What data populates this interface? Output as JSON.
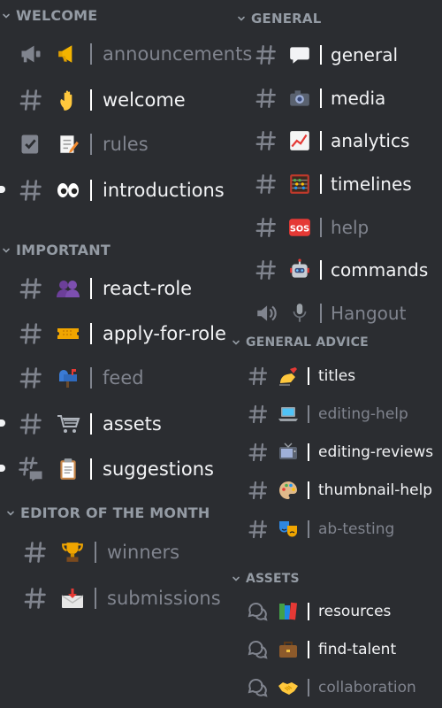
{
  "left": {
    "welcome": {
      "header": "WELCOME",
      "channels": [
        {
          "name": "announcements",
          "icon": "megaphone-icon",
          "emoji": "megaphone-emoji",
          "unread": false
        },
        {
          "name": "welcome",
          "icon": "hash-icon",
          "emoji": "waving-hand-emoji",
          "unread": true
        },
        {
          "name": "rules",
          "icon": "rules-icon",
          "emoji": "memo-emoji",
          "unread": false
        },
        {
          "name": "introductions",
          "icon": "hash-icon",
          "emoji": "eyes-emoji",
          "unread": true
        }
      ]
    },
    "important": {
      "header": "IMPORTANT",
      "channels": [
        {
          "name": "react-role",
          "icon": "hash-icon",
          "emoji": "people-emoji",
          "unread": true
        },
        {
          "name": "apply-for-role",
          "icon": "hash-icon",
          "emoji": "ticket-emoji",
          "unread": true
        },
        {
          "name": "feed",
          "icon": "hash-icon",
          "emoji": "mailbox-emoji",
          "unread": false
        },
        {
          "name": "assets",
          "icon": "hash-icon",
          "emoji": "cart-emoji",
          "unread": true
        },
        {
          "name": "suggestions",
          "icon": "thread-hash-icon",
          "emoji": "clipboard-emoji",
          "unread": true
        }
      ]
    },
    "editor": {
      "header": "EDITOR OF THE MONTH",
      "channels": [
        {
          "name": "winners",
          "icon": "hash-icon",
          "emoji": "trophy-emoji",
          "unread": false
        },
        {
          "name": "submissions",
          "icon": "hash-icon",
          "emoji": "inbox-emoji",
          "unread": false
        }
      ]
    }
  },
  "right": {
    "general": {
      "header": "GENERAL",
      "channels": [
        {
          "name": "general",
          "icon": "hash-icon",
          "emoji": "speech-bubble-emoji",
          "unread": true
        },
        {
          "name": "media",
          "icon": "hash-icon",
          "emoji": "camera-emoji",
          "unread": true
        },
        {
          "name": "analytics",
          "icon": "hash-icon",
          "emoji": "chart-emoji",
          "unread": true
        },
        {
          "name": "timelines",
          "icon": "hash-icon",
          "emoji": "abacus-emoji",
          "unread": true
        },
        {
          "name": "help",
          "icon": "hash-icon",
          "emoji": "sos-emoji",
          "unread": false
        },
        {
          "name": "commands",
          "icon": "hash-icon",
          "emoji": "robot-emoji",
          "unread": true
        },
        {
          "name": "Hangout",
          "icon": "voice-icon",
          "emoji": "microphone-emoji",
          "unread": false
        }
      ]
    },
    "advice": {
      "header": "GENERAL ADVICE",
      "channels": [
        {
          "name": "titles",
          "icon": "hash-icon",
          "emoji": "writing-hand-emoji",
          "unread": true
        },
        {
          "name": "editing-help",
          "icon": "hash-icon",
          "emoji": "laptop-emoji",
          "unread": false
        },
        {
          "name": "editing-reviews",
          "icon": "hash-icon",
          "emoji": "tv-emoji",
          "unread": true
        },
        {
          "name": "thumbnail-help",
          "icon": "hash-icon",
          "emoji": "palette-emoji",
          "unread": true
        },
        {
          "name": "ab-testing",
          "icon": "hash-icon",
          "emoji": "masks-emoji",
          "unread": false
        }
      ]
    },
    "assets": {
      "header": "ASSETS",
      "channels": [
        {
          "name": "resources",
          "icon": "forum-icon",
          "emoji": "books-emoji",
          "unread": true
        },
        {
          "name": "find-talent",
          "icon": "forum-icon",
          "emoji": "briefcase-emoji",
          "unread": true
        },
        {
          "name": "collaboration",
          "icon": "forum-icon",
          "emoji": "handshake-emoji",
          "unread": false
        }
      ]
    }
  },
  "colors": {
    "background": "#2b2d31",
    "header": "#949ba4",
    "muted": "#80848e",
    "unread": "#f2f3f5"
  }
}
